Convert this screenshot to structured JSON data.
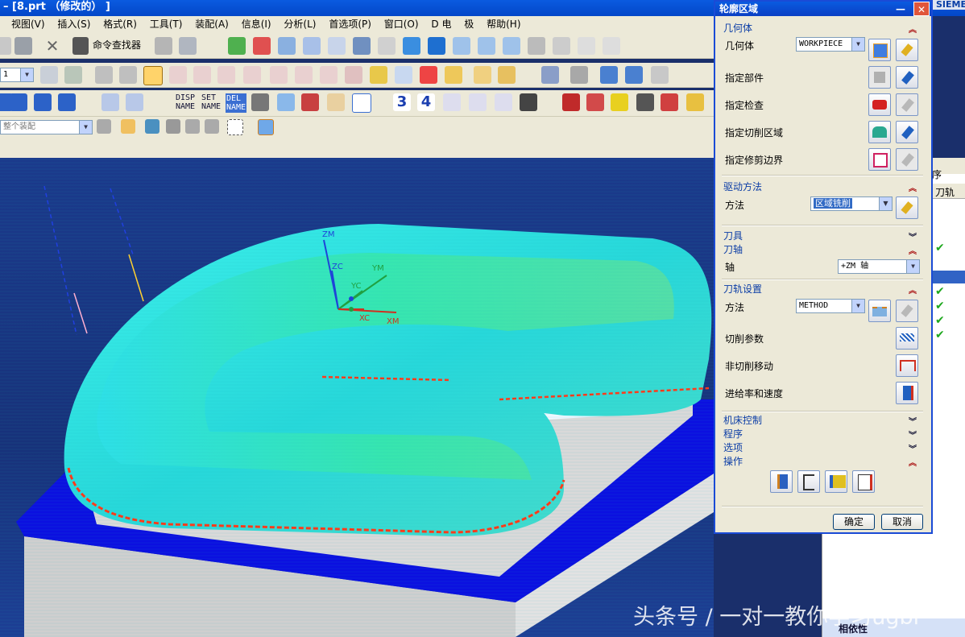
{
  "title": "– [8.prt （修改的） ]",
  "menu": [
    "视图(V)",
    "插入(S)",
    "格式(R)",
    "工具(T)",
    "装配(A)",
    "信息(I)",
    "分析(L)",
    "首选项(P)",
    "窗口(O)",
    "D 电",
    "极",
    "帮助(H)"
  ],
  "toolbar": {
    "command_finder": "命令查找器",
    "layer_value": "1",
    "assembly_filter": "整个装配",
    "disp_name": [
      "DISP",
      "NAME"
    ],
    "set_name": [
      "SET",
      "NAME"
    ],
    "del_name": [
      "DEL",
      "NAME"
    ]
  },
  "viewport": {
    "axis_labels": {
      "zm": "ZM",
      "zc": "ZC",
      "ym": "YM",
      "yc": "YC",
      "xc": "XC",
      "xm": "XM"
    }
  },
  "navigator": {
    "header": "序",
    "col_toolpath": "刀轨",
    "footer": "相依性",
    "brand": "SIEME"
  },
  "dialog": {
    "title": "轮廓区域",
    "geometry": {
      "section": "几何体",
      "geometry_label": "几何体",
      "geometry_value": "WORKPIECE",
      "specify_part": "指定部件",
      "specify_check": "指定检查",
      "specify_cut_area": "指定切削区域",
      "specify_trim": "指定修剪边界"
    },
    "drive": {
      "section": "驱动方法",
      "method_label": "方法",
      "method_value": "区域铣削"
    },
    "tool": {
      "section": "刀具"
    },
    "axis": {
      "section": "刀轴",
      "axis_label": "轴",
      "axis_value": "+ZM 轴"
    },
    "path_settings": {
      "section": "刀轨设置",
      "method_label": "方法",
      "method_value": "METHOD",
      "cut_params": "切削参数",
      "non_cut_moves": "非切削移动",
      "feeds_speeds": "进给率和速度"
    },
    "machine_control": {
      "section": "机床控制"
    },
    "program": {
      "section": "程序"
    },
    "options": {
      "section": "选项"
    },
    "actions": {
      "section": "操作"
    },
    "ok": "确定",
    "cancel": "取消"
  },
  "watermark": "头条号 / 一对一教你学习ugbi",
  "colors": {
    "title_bar": "#0a5be0",
    "viewport": "#1b3a8c",
    "blank_top": "#0b10e0",
    "toolpath_cyan": "#2ee8e0",
    "dialog_bg": "#ece9d8",
    "check_green": "#1ea81e"
  }
}
